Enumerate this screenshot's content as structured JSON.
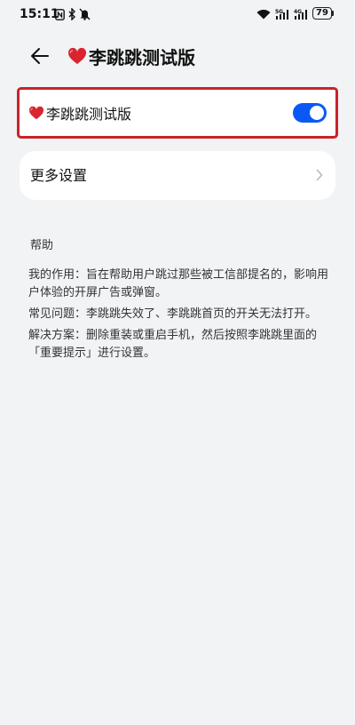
{
  "status_bar": {
    "time": "15:11",
    "battery": "79",
    "icons": [
      "nfc-icon",
      "bluetooth-icon",
      "mute-icon",
      "wifi-icon",
      "signal-5g-icon",
      "signal-4g-icon",
      "battery-icon"
    ]
  },
  "header": {
    "back_icon": "back-arrow-icon",
    "title_icon": "heart-icon",
    "title": "李跳跳测试版"
  },
  "toggle_card": {
    "icon": "heart-icon",
    "label": "李跳跳测试版",
    "enabled": true,
    "accent": "#0a59f7",
    "highlight_color": "#c8232a"
  },
  "more_settings": {
    "label": "更多设置",
    "chevron_icon": "chevron-right-icon"
  },
  "help": {
    "heading": "帮助",
    "paragraphs": [
      "我的作用：旨在帮助用户跳过那些被工信部提名的，影响用户体验的开屏广告或弹窗。",
      "常见问题：李跳跳失效了、李跳跳首页的开关无法打开。",
      "解决方案：删除重装或重启手机，然后按照李跳跳里面的「重要提示」进行设置。"
    ]
  }
}
